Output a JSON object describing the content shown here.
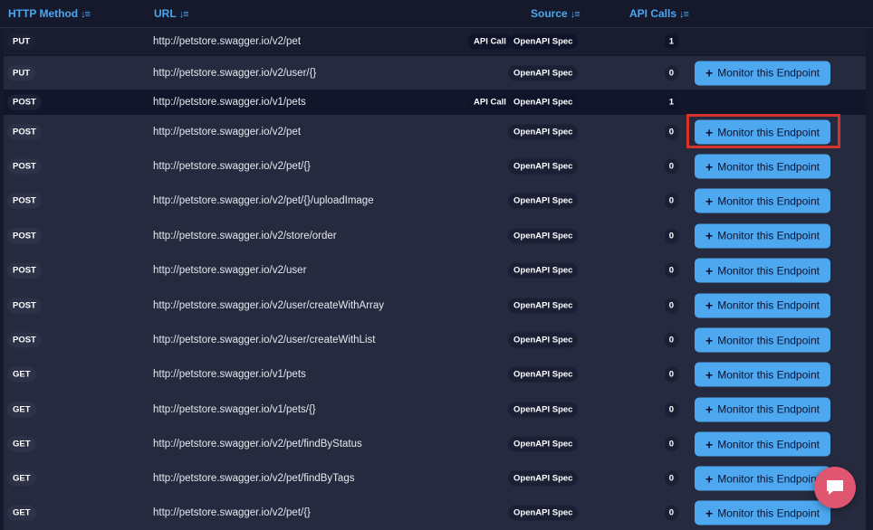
{
  "header": {
    "method": "HTTP Method",
    "url": "URL",
    "source": "Source",
    "api_calls": "API Calls"
  },
  "rows": [
    {
      "method": "PUT",
      "url": "http://petstore.swagger.io/v2/pet",
      "api_call": "API Call",
      "source": "OpenAPI Spec",
      "calls": "1",
      "monitor": ""
    },
    {
      "method": "PUT",
      "url": "http://petstore.swagger.io/v2/user/{}",
      "api_call": "",
      "source": "OpenAPI Spec",
      "calls": "0",
      "monitor": "Monitor this Endpoint"
    },
    {
      "method": "POST",
      "url": "http://petstore.swagger.io/v1/pets",
      "api_call": "API Call",
      "source": "OpenAPI Spec",
      "calls": "1",
      "monitor": ""
    },
    {
      "method": "POST",
      "url": "http://petstore.swagger.io/v2/pet",
      "api_call": "",
      "source": "OpenAPI Spec",
      "calls": "0",
      "monitor": "Monitor this Endpoint"
    },
    {
      "method": "POST",
      "url": "http://petstore.swagger.io/v2/pet/{}",
      "api_call": "",
      "source": "OpenAPI Spec",
      "calls": "0",
      "monitor": "Monitor this Endpoint"
    },
    {
      "method": "POST",
      "url": "http://petstore.swagger.io/v2/pet/{}/uploadImage",
      "api_call": "",
      "source": "OpenAPI Spec",
      "calls": "0",
      "monitor": "Monitor this Endpoint"
    },
    {
      "method": "POST",
      "url": "http://petstore.swagger.io/v2/store/order",
      "api_call": "",
      "source": "OpenAPI Spec",
      "calls": "0",
      "monitor": "Monitor this Endpoint"
    },
    {
      "method": "POST",
      "url": "http://petstore.swagger.io/v2/user",
      "api_call": "",
      "source": "OpenAPI Spec",
      "calls": "0",
      "monitor": "Monitor this Endpoint"
    },
    {
      "method": "POST",
      "url": "http://petstore.swagger.io/v2/user/createWithArray",
      "api_call": "",
      "source": "OpenAPI Spec",
      "calls": "0",
      "monitor": "Monitor this Endpoint"
    },
    {
      "method": "POST",
      "url": "http://petstore.swagger.io/v2/user/createWithList",
      "api_call": "",
      "source": "OpenAPI Spec",
      "calls": "0",
      "monitor": "Monitor this Endpoint"
    },
    {
      "method": "GET",
      "url": "http://petstore.swagger.io/v1/pets",
      "api_call": "",
      "source": "OpenAPI Spec",
      "calls": "0",
      "monitor": "Monitor this Endpoint"
    },
    {
      "method": "GET",
      "url": "http://petstore.swagger.io/v1/pets/{}",
      "api_call": "",
      "source": "OpenAPI Spec",
      "calls": "0",
      "monitor": "Monitor this Endpoint"
    },
    {
      "method": "GET",
      "url": "http://petstore.swagger.io/v2/pet/findByStatus",
      "api_call": "",
      "source": "OpenAPI Spec",
      "calls": "0",
      "monitor": "Monitor this Endpoint"
    },
    {
      "method": "GET",
      "url": "http://petstore.swagger.io/v2/pet/findByTags",
      "api_call": "",
      "source": "OpenAPI Spec",
      "calls": "0",
      "monitor": "Monitor this Endpoint"
    },
    {
      "method": "GET",
      "url": "http://petstore.swagger.io/v2/pet/{}",
      "api_call": "",
      "source": "OpenAPI Spec",
      "calls": "0",
      "monitor": "Monitor this Endpoint"
    }
  ],
  "colors": {
    "accent": "#4aa8f0",
    "button": "#4da8ef",
    "highlight": "#d6332a",
    "chat": "#e0556f"
  },
  "icons": {
    "sort": "sort-icon",
    "plus": "plus-icon",
    "chat": "chat-icon"
  }
}
